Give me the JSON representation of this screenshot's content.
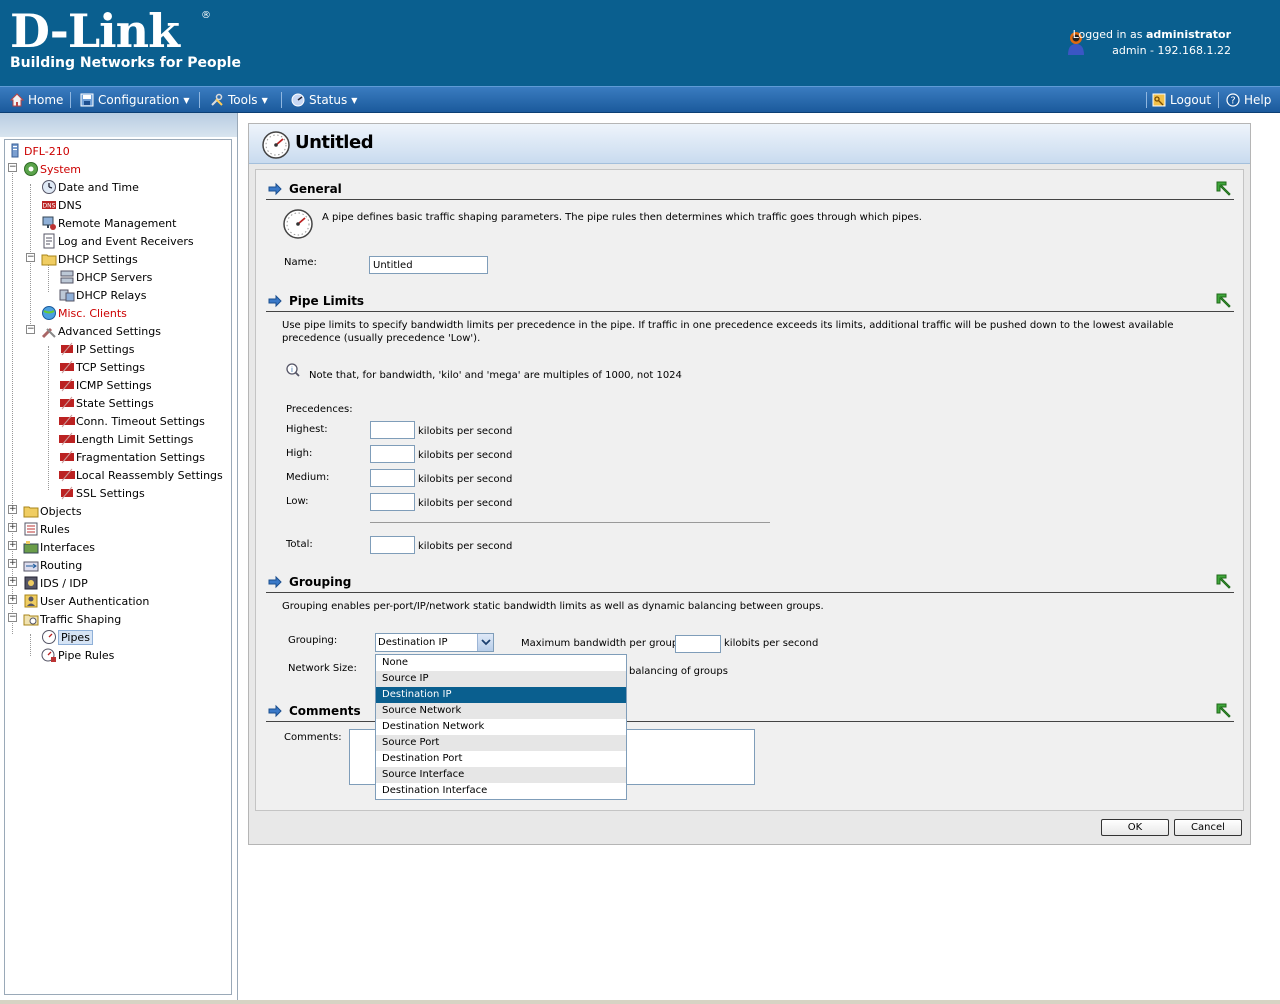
{
  "brand": {
    "logo": "D-Link",
    "registered": "®",
    "tagline": "Building Networks for People"
  },
  "session": {
    "logged_in_prefix": "Logged in as",
    "user": "administrator",
    "detail": "admin - 192.168.1.22"
  },
  "menu": {
    "home": "Home",
    "configuration": "Configuration",
    "tools": "Tools",
    "status": "Status",
    "logout": "Logout",
    "help": "Help"
  },
  "tree": {
    "root": "DFL-210",
    "system": "System",
    "date_time": "Date and Time",
    "dns": "DNS",
    "remote_mgmt": "Remote Management",
    "log_receivers": "Log and Event Receivers",
    "dhcp_settings": "DHCP Settings",
    "dhcp_servers": "DHCP Servers",
    "dhcp_relays": "DHCP Relays",
    "misc_clients": "Misc. Clients",
    "advanced": "Advanced Settings",
    "ip_settings": "IP Settings",
    "tcp_settings": "TCP Settings",
    "icmp_settings": "ICMP Settings",
    "state_settings": "State Settings",
    "conn_timeout": "Conn. Timeout Settings",
    "length_limit": "Length Limit Settings",
    "fragmentation": "Fragmentation Settings",
    "local_reassembly": "Local Reassembly Settings",
    "ssl_settings": "SSL Settings",
    "objects": "Objects",
    "rules": "Rules",
    "interfaces": "Interfaces",
    "routing": "Routing",
    "ids_idp": "IDS / IDP",
    "user_auth": "User Authentication",
    "traffic_shaping": "Traffic Shaping",
    "pipes": "Pipes",
    "pipe_rules": "Pipe Rules"
  },
  "page": {
    "title": "Untitled"
  },
  "general": {
    "heading": "General",
    "description": "A pipe defines basic traffic shaping parameters. The pipe rules then determines which traffic goes through which pipes.",
    "name_label": "Name:",
    "name_value": "Untitled"
  },
  "pipe_limits": {
    "heading": "Pipe Limits",
    "description": "Use pipe limits to specify bandwidth limits per precedence in the pipe. If traffic in one precedence exceeds its limits, additional traffic will be pushed down to the lowest available precedence (usually precedence 'Low').",
    "note": "Note that, for bandwidth, 'kilo' and 'mega' are multiples of 1000, not 1024",
    "precedences_label": "Precedences:",
    "highest": "Highest:",
    "high": "High:",
    "medium": "Medium:",
    "low": "Low:",
    "total": "Total:",
    "unit": "kilobits per second"
  },
  "grouping": {
    "heading": "Grouping",
    "description": "Grouping enables per-port/IP/network static bandwidth limits as well as dynamic balancing between groups.",
    "grouping_label": "Grouping:",
    "selected": "Destination IP",
    "max_bw_label": "Maximum bandwidth per group:",
    "unit": "kilobits per second",
    "network_size_label": "Network Size:",
    "balancing_text": "balancing of groups",
    "options": [
      "None",
      "Source IP",
      "Destination IP",
      "Source Network",
      "Destination Network",
      "Source Port",
      "Destination Port",
      "Source Interface",
      "Destination Interface"
    ]
  },
  "comments": {
    "heading": "Comments",
    "label": "Comments:"
  },
  "buttons": {
    "ok": "OK",
    "cancel": "Cancel"
  }
}
